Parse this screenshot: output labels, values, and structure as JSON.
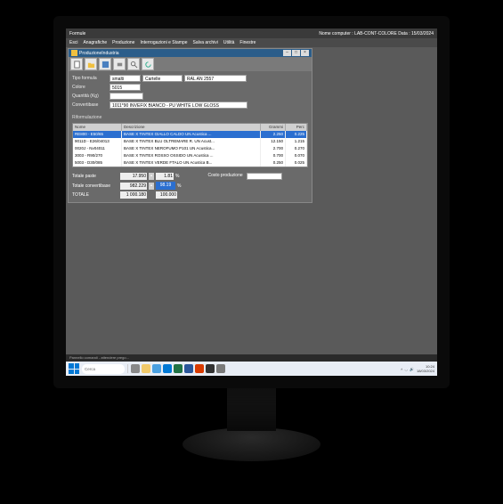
{
  "app": {
    "title": "Formule",
    "status_right": "Nome computer : LAB-CONT-COLORE   Data : 15/03/2024",
    "menubar": [
      "Esci",
      "Anagrafiche",
      "Produzione",
      "Interrogazioni e Stampe",
      "Salva archivi",
      "Utilità",
      "Finestre"
    ]
  },
  "child": {
    "title": "ProduzioneIndustria",
    "toolbar_icons": [
      "file",
      "open",
      "save",
      "print",
      "search",
      "refresh"
    ]
  },
  "form": {
    "tipo_formula_label": "Tipo formula",
    "tipo_formula_val1": "smalti",
    "tipo_formula_val2": "Cartelle",
    "tipo_formula_val3": "RAL  AN  2557",
    "colore_label": "Colore",
    "colore_val": "5015",
    "quantita_label": "Quantità (Kg)",
    "quantita_val": "",
    "convertibase_label": "Convertibase",
    "convertibase_val": "1011*90 INVEFIX BIANCO - PU WHITE LOW GLOSS",
    "section": "Riformulazione"
  },
  "table": {
    "headers": [
      "Nome",
      "Descrizione",
      "Grammi",
      "Perc"
    ],
    "rows": [
      {
        "name": "RE800 - E50/65",
        "desc": "BASE X TINTEX GIALLO CALDO UN Acustica ...",
        "qty": "2.250",
        "pct": "0.225",
        "selected": true
      },
      {
        "name": "9011D - E26/04013",
        "desc": "BASE X TINTEX BLU OLTREMARE R. UN Acust...",
        "qty": "12.150",
        "pct": "1.215",
        "selected": false
      },
      {
        "name": "0020J - Nv04011",
        "desc": "BASE X TINTEX NEROFUMO P101 UN Acustica...",
        "qty": "2.700",
        "pct": "0.270",
        "selected": false
      },
      {
        "name": "3003 - R90/270",
        "desc": "BASE X TINTEX ROSSO OSSIDO UN Acustica ...",
        "qty": "0.700",
        "pct": "0.070",
        "selected": false
      },
      {
        "name": "5003 - D30/085",
        "desc": "BASE X TINTEX VERDE FTALO UN Acustica B...",
        "qty": "0.250",
        "pct": "0.025",
        "selected": false
      }
    ]
  },
  "totals": {
    "paste_label": "Totale paste",
    "paste_val": "17.950",
    "paste_pct": "1.81",
    "convertibase_label": "Totale convertibase",
    "convertibase_val": "982.229",
    "convertibase_pct": "98.19",
    "totale_label": "TOTALE",
    "totale_val": "1 000.180",
    "totale_unit": "100.000",
    "costo_label": "Costo produzione",
    "costo_val": "",
    "pct_unit": "%"
  },
  "desktop": {
    "statusbar": "Pannello comandi - attendere prego...",
    "search_placeholder": "Cerca",
    "clock_time": "10:24",
    "clock_date": "18/03/2024",
    "taskbar_icons": [
      {
        "name": "task-view",
        "color": "#888"
      },
      {
        "name": "explorer",
        "color": "#f0c96a"
      },
      {
        "name": "edge",
        "color": "#4aa0e0"
      },
      {
        "name": "mail",
        "color": "#0078d4"
      },
      {
        "name": "excel",
        "color": "#217346"
      },
      {
        "name": "word",
        "color": "#2b579a"
      },
      {
        "name": "app1",
        "color": "#d83b01"
      },
      {
        "name": "app2",
        "color": "#333"
      },
      {
        "name": "app3",
        "color": "#7a7a7a"
      }
    ]
  }
}
